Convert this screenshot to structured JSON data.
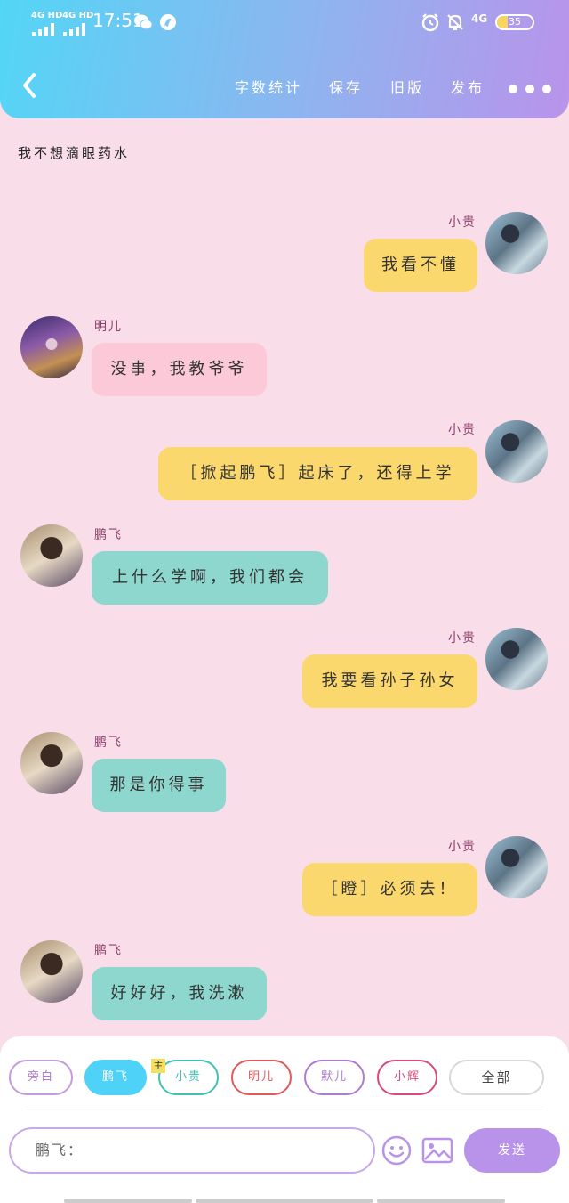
{
  "status_bar": {
    "sim1": "4G HD",
    "sim2": "4G HD",
    "time": "17:51",
    "network": "4G",
    "battery": "35"
  },
  "toolbar": {
    "word_count": "字数统计",
    "save": "保存",
    "old_version": "旧版",
    "publish": "发布"
  },
  "story_title": "我不想滴眼药水",
  "messages": [
    {
      "side": "right",
      "name": "小贵",
      "text": "我看不懂",
      "color": "#fbd86d"
    },
    {
      "side": "left",
      "name": "明儿",
      "text": "没事，我教爷爷",
      "color": "#fbc9d8"
    },
    {
      "side": "right",
      "name": "小贵",
      "text": "［掀起鹏飞］起床了，还得上学",
      "color": "#fbd86d"
    },
    {
      "side": "left",
      "name": "鹏飞",
      "text": "上什么学啊，我们都会",
      "color": "#8dd7cf"
    },
    {
      "side": "right",
      "name": "小贵",
      "text": "我要看孙子孙女",
      "color": "#fbd86d"
    },
    {
      "side": "left",
      "name": "鹏飞",
      "text": "那是你得事",
      "color": "#8dd7cf"
    },
    {
      "side": "right",
      "name": "小贵",
      "text": "［瞪］必须去！",
      "color": "#fbd86d"
    },
    {
      "side": "left",
      "name": "鹏飞",
      "text": "好好好，我洗漱",
      "color": "#8dd7cf"
    }
  ],
  "roles": [
    {
      "label": "旁白",
      "color": "#c59be0"
    },
    {
      "label": "鹏飞",
      "color": "#4fd2f7"
    },
    {
      "label": "小贵",
      "color": "#3fc2b4"
    },
    {
      "label": "明儿",
      "color": "#e05a5a"
    },
    {
      "label": "默儿",
      "color": "#b07ad0"
    },
    {
      "label": "小辉",
      "color": "#d9487c"
    },
    {
      "label": "全部",
      "color": "#cccccc"
    }
  ],
  "main_badge": "主",
  "composer": {
    "input_value": "鹏飞：",
    "send_label": "发送"
  },
  "icons": [
    "back-arrow-icon",
    "more-dots-icon",
    "emoji-icon",
    "image-icon",
    "alarm-icon",
    "mute-bell-icon",
    "wechat-icon",
    "browser-icon"
  ]
}
